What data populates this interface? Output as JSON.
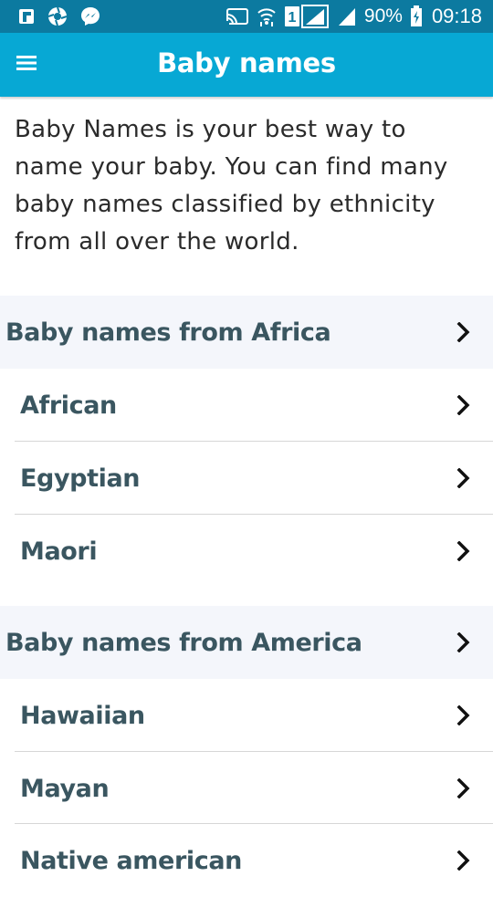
{
  "status_bar": {
    "battery_percent": "90%",
    "time": "09:18",
    "sim_slot": "1",
    "icons": [
      "flipboard-icon",
      "aperture-icon",
      "messenger-icon",
      "cast-icon",
      "wifi-icon",
      "sim-signal-icon",
      "signal-icon",
      "battery-charging-icon"
    ]
  },
  "app_bar": {
    "title": "Baby names",
    "menu_icon": "hamburger-menu-icon",
    "background": "#07a8d4"
  },
  "intro": {
    "text": "Baby Names is your best way to name your baby. You can find many baby names classified by ethnicity from all over the world."
  },
  "sections": [
    {
      "title": "Baby names from Africa",
      "items": [
        "African",
        "Egyptian",
        "Maori"
      ]
    },
    {
      "title": "Baby names from America",
      "items": [
        "Hawaiian",
        "Mayan",
        "Native american"
      ]
    }
  ],
  "colors": {
    "status_bar": "#0c7aa0",
    "app_bar": "#07a8d4",
    "section_background": "#f4f6fb",
    "item_text": "#3a5660",
    "chevron": "#111111"
  },
  "chevron_icon": "chevron-right-icon"
}
